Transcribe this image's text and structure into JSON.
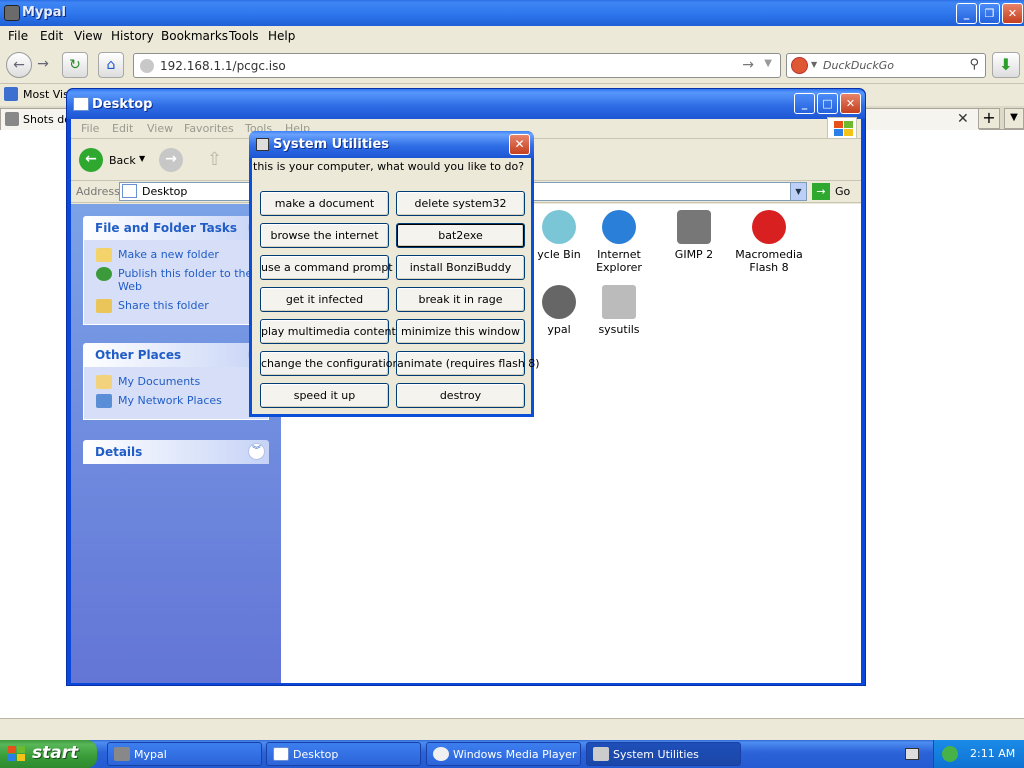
{
  "browser": {
    "title": "Mypal",
    "menu": [
      "File",
      "Edit",
      "View",
      "History",
      "Bookmarks",
      "Tools",
      "Help"
    ],
    "url": "192.168.1.1/pcgc.iso",
    "search_placeholder": "DuckDuckGo",
    "bookmark_label": "Most Visi",
    "tab_label": "Shots do"
  },
  "explorer": {
    "title": "Desktop",
    "menu": [
      "File",
      "Edit",
      "View",
      "Favorites",
      "Tools",
      "Help"
    ],
    "back_label": "Back",
    "address_label": "Address",
    "address_value": "Desktop",
    "go_label": "Go",
    "file_tasks": {
      "title": "File and Folder Tasks",
      "items": [
        "Make a new folder",
        "Publish this folder to the Web",
        "Share this folder"
      ]
    },
    "other_places": {
      "title": "Other Places",
      "items": [
        "My Documents",
        "My Network Places"
      ]
    },
    "details": {
      "title": "Details"
    },
    "icons": [
      {
        "label": "ycle Bin"
      },
      {
        "label": "Internet Explorer"
      },
      {
        "label": "GIMP 2"
      },
      {
        "label": "Macromedia Flash 8"
      },
      {
        "label": "ypal"
      },
      {
        "label": "sysutils"
      }
    ]
  },
  "dialog": {
    "title": "System Utilities",
    "prompt": "this is your computer, what would you like to do?",
    "buttons": [
      "make a document",
      "delete system32",
      "browse the internet",
      "bat2exe",
      "use a command prompt",
      "install BonziBuddy",
      "get it infected",
      "break it in rage",
      "play multimedia content",
      "minimize this window",
      "change the configuration",
      "animate (requires flash 8)",
      "speed it up",
      "destroy"
    ]
  },
  "taskbar": {
    "start_label": "start",
    "items": [
      "Mypal",
      "Desktop",
      "Windows Media Player",
      "System Utilities"
    ],
    "clock": "2:11 AM"
  }
}
